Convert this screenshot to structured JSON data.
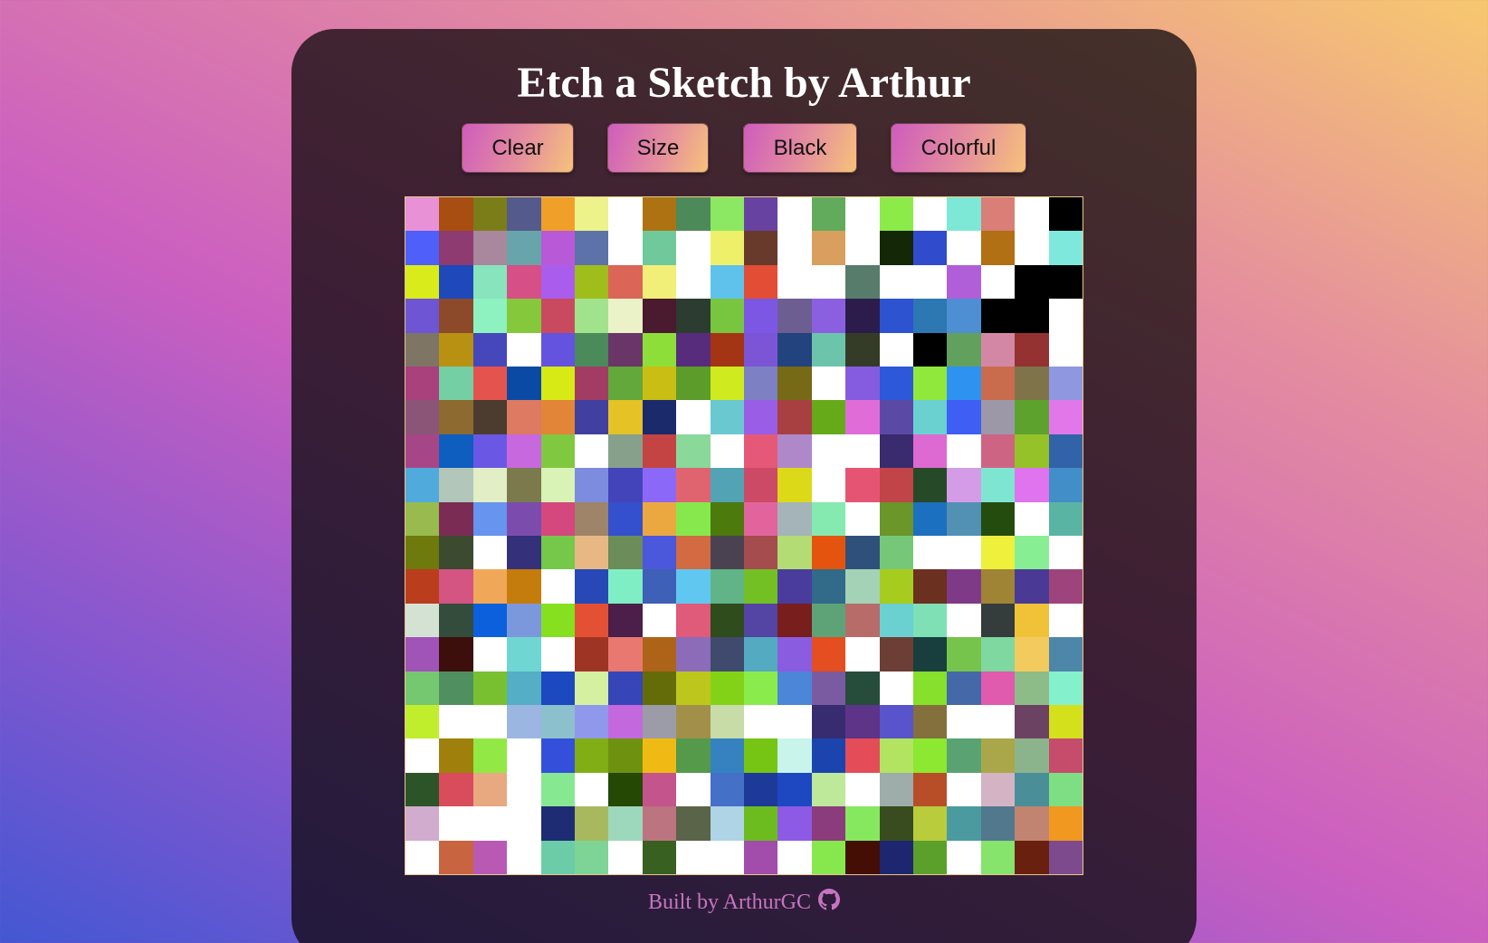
{
  "title": "Etch a Sketch by Arthur",
  "buttons": {
    "clear": "Clear",
    "size": "Size",
    "black": "Black",
    "colorful": "Colorful"
  },
  "grid": {
    "rows": 20,
    "cols": 20,
    "cells": [
      [
        "#e891d7",
        "#a94e12",
        "#7b7e18",
        "#555a8c",
        "#f0a028",
        "#eef28a",
        "#ffffff",
        "#ad7312",
        "#4d8a5a",
        "#8ce862",
        "#6742a0",
        "#ffffff",
        "#62ab5c",
        "#ffffff",
        "#8ceb48",
        "#ffffff",
        "#7ee8d6",
        "#da7e78",
        "#ffffff",
        "#000000"
      ],
      [
        "#4e5ffa",
        "#8d3b70",
        "#a9879c",
        "#67a5ab",
        "#b85ad8",
        "#5d72a8",
        "#ffffff",
        "#6fc99b",
        "#ffffff",
        "#eef06a",
        "#683a2c",
        "#ffffff",
        "#d99f5e",
        "#ffffff",
        "#142807",
        "#314bcd",
        "#ffffff",
        "#b17013",
        "#ffffff",
        "#7ee8dc"
      ],
      [
        "#d9eb1a",
        "#1f48ba",
        "#88e4bc",
        "#d64f86",
        "#aa5ded",
        "#9fbd1b",
        "#db6658",
        "#f2ef78",
        "#ffffff",
        "#5fc2eb",
        "#e24d35",
        "#ffffff",
        "#ffffff",
        "#577c6b",
        "#ffffff",
        "#ffffff",
        "#b05fd9",
        "#ffffff",
        "#000000",
        "#000000"
      ],
      [
        "#6e55d4",
        "#8c4a2a",
        "#8ef2c0",
        "#86c83c",
        "#c94a5e",
        "#a1e38c",
        "#ebf2c8",
        "#4a1a2e",
        "#2d3c30",
        "#78c540",
        "#7c57e3",
        "#6d5e92",
        "#8a60e0",
        "#2c1c4c",
        "#2e53d0",
        "#2d78b2",
        "#4d8fd2",
        "#000000",
        "#000000",
        "#ffffff"
      ],
      [
        "#7e7565",
        "#b89012",
        "#4547ba",
        "#ffffff",
        "#6453de",
        "#4b8a5a",
        "#6a3668",
        "#8ede3a",
        "#582c7c",
        "#a33414",
        "#7b55d6",
        "#22437e",
        "#6cc4ab",
        "#343c28",
        "#ffffff",
        "#000000",
        "#62a05e",
        "#d487a5",
        "#933230",
        "#ffffff"
      ],
      [
        "#a8417c",
        "#74cfa5",
        "#e5534f",
        "#0a4aa5",
        "#d7ea15",
        "#a23c63",
        "#62a83a",
        "#c9be14",
        "#5c9c2a",
        "#cfeb1f",
        "#7d80c2",
        "#766a17",
        "#ffffff",
        "#855ce0",
        "#2c58d9",
        "#90e83c",
        "#2e92f0",
        "#c86c4d",
        "#7f7449",
        "#8f97e0"
      ],
      [
        "#8a5577",
        "#8d6a30",
        "#4b3c2f",
        "#dd7a61",
        "#e38538",
        "#4140a0",
        "#e5c226",
        "#1a2a6a",
        "#ffffff",
        "#6ac8d0",
        "#9a5ee6",
        "#a84042",
        "#66aa1a",
        "#e06cd8",
        "#5a4aa6",
        "#6ad0d0",
        "#3e5ef4",
        "#9c98a8",
        "#5ea22e",
        "#e078ea"
      ],
      [
        "#a64686",
        "#0e5ec0",
        "#6a58e4",
        "#c868de",
        "#80c840",
        "#ffffff",
        "#86a08c",
        "#c44444",
        "#8ad89a",
        "#ffffff",
        "#e65878",
        "#ae88c8",
        "#ffffff",
        "#ffffff",
        "#3a2a6e",
        "#dc6ad2",
        "#ffffff",
        "#ce6484",
        "#94c228",
        "#3262a8"
      ],
      [
        "#50aadc",
        "#b2c6ba",
        "#e1eec6",
        "#7a7a4c",
        "#d9f2b6",
        "#7e8ce0",
        "#4444ba",
        "#8c68f8",
        "#e06470",
        "#52a4b4",
        "#cc4a66",
        "#dcda18",
        "#ffffff",
        "#e65474",
        "#c04448",
        "#264a28",
        "#d49ce6",
        "#7ee6d0",
        "#e074ee",
        "#428ec8"
      ],
      [
        "#98ba4e",
        "#7a2c54",
        "#6694ee",
        "#7c4cac",
        "#d4487e",
        "#9e8468",
        "#3450cc",
        "#eca840",
        "#86e84c",
        "#4c7a0c",
        "#e2649c",
        "#a4b4b8",
        "#84eab0",
        "#ffffff",
        "#6a962a",
        "#1c70c0",
        "#5290b4",
        "#244c0e",
        "#ffffff",
        "#5ab4a4"
      ],
      [
        "#6e7a0c",
        "#3c4a30",
        "#ffffff",
        "#34307a",
        "#76c84a",
        "#e8b884",
        "#6c8c5a",
        "#4c58dc",
        "#d26a42",
        "#4a4250",
        "#a44c4e",
        "#b4dc74",
        "#e4540e",
        "#30507c",
        "#76c878",
        "#ffffff",
        "#ffffff",
        "#eef03c",
        "#88ee94",
        "#ffffff"
      ],
      [
        "#ba3e1e",
        "#d45482",
        "#f0a858",
        "#c47c0c",
        "#ffffff",
        "#2848b8",
        "#80eec4",
        "#3e60b6",
        "#60c8f0",
        "#60b488",
        "#72c024",
        "#4a3c9c",
        "#326a8a",
        "#a4d2b6",
        "#a6cc20",
        "#6c3020",
        "#7e3a86",
        "#9e8434",
        "#4a3a96",
        "#9e447c"
      ],
      [
        "#d4e2d4",
        "#344c3c",
        "#0c60dc",
        "#7c98dc",
        "#86e020",
        "#e45034",
        "#4c1e4a",
        "#ffffff",
        "#e05a7a",
        "#2e4c1c",
        "#5444a4",
        "#781e1c",
        "#5ea278",
        "#b86c6a",
        "#6ad0d0",
        "#7ee0b4",
        "#ffffff",
        "#343c3c",
        "#f0c238",
        "#ffffff"
      ],
      [
        "#a054b8",
        "#3c0e0c",
        "#ffffff",
        "#70d6d2",
        "#ffffff",
        "#9e3424",
        "#e87870",
        "#ae6418",
        "#8c6cb8",
        "#404a6c",
        "#54aac0",
        "#8a5ce0",
        "#e44e20",
        "#ffffff",
        "#6c3e36",
        "#183e3e",
        "#76c44c",
        "#7ed8a0",
        "#f2ca5e",
        "#4e86aa"
      ],
      [
        "#76c870",
        "#509060",
        "#78c030",
        "#54aec6",
        "#1c48c0",
        "#d4f0a0",
        "#3646b8",
        "#646c0a",
        "#bcc61c",
        "#84d218",
        "#8aec4c",
        "#4c86d8",
        "#7a5aa0",
        "#264c3c",
        "#ffffff",
        "#86e02c",
        "#4468a8",
        "#e05aae",
        "#8ebc88",
        "#84f0cc"
      ],
      [
        "#c0ee2c",
        "#ffffff",
        "#ffffff",
        "#9cb6e2",
        "#8cc0cc",
        "#9098ec",
        "#c468de",
        "#9c9ca8",
        "#a2904a",
        "#c8dca8",
        "#ffffff",
        "#ffffff",
        "#382c70",
        "#5e3488",
        "#5a54cc",
        "#84703c",
        "#ffffff",
        "#ffffff",
        "#6c4262",
        "#d4e01c"
      ],
      [
        "#ffffff",
        "#a0800c",
        "#92e844",
        "#ffffff",
        "#3450da",
        "#80ae14",
        "#6e9210",
        "#f0ba14",
        "#549a4a",
        "#3682c0",
        "#76c414",
        "#c8f4ec",
        "#1c44ae",
        "#e44c58",
        "#b2e462",
        "#8ce830",
        "#5aa272",
        "#aaa64a",
        "#8cb48c",
        "#c64c6c"
      ],
      [
        "#2c5428",
        "#d84c5c",
        "#e8a880",
        "#ffffff",
        "#86e890",
        "#ffffff",
        "#254804",
        "#c4548c",
        "#ffffff",
        "#4470c8",
        "#1e3a98",
        "#1e48c2",
        "#bee89a",
        "#ffffff",
        "#9eacaa",
        "#b84e28",
        "#ffffff",
        "#d4b4c4",
        "#4a8e98",
        "#7ede84"
      ],
      [
        "#d2acce",
        "#ffffff",
        "#ffffff",
        "#ffffff",
        "#1e2c74",
        "#a8b85e",
        "#9ed8bc",
        "#bc7480",
        "#5a6448",
        "#aed4e6",
        "#6cbc20",
        "#8c5ae4",
        "#8a3c7c",
        "#86e85e",
        "#384c20",
        "#b8cc3c",
        "#4a9aa0",
        "#52788e",
        "#c08470",
        "#f09820"
      ],
      [
        "#ffffff",
        "#c86440",
        "#b85ab4",
        "#ffffff",
        "#6ccca8",
        "#7ed494",
        "#ffffff",
        "#386020",
        "#ffffff",
        "#ffffff",
        "#a24cac",
        "#ffffff",
        "#86e84c",
        "#440e04",
        "#1e2670",
        "#5ca02c",
        "#ffffff",
        "#86e46c",
        "#6a200e",
        "#7e4a8e"
      ]
    ]
  },
  "footer": {
    "text": "Built by ArthurGC",
    "icon": "github-icon"
  }
}
